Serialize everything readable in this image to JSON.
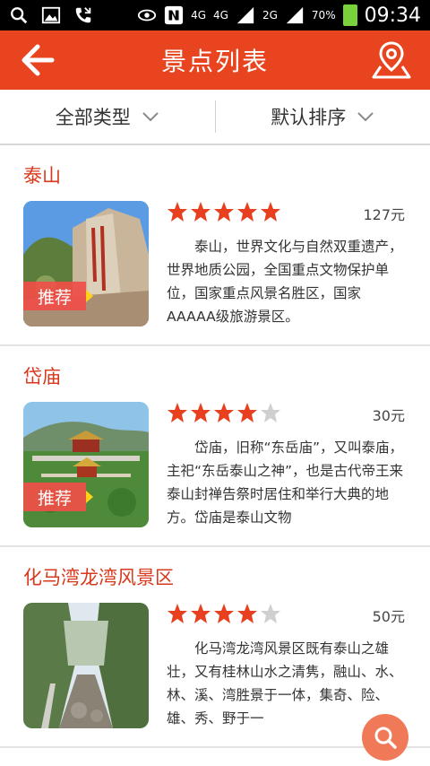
{
  "status_bar": {
    "icons": [
      "search-icon",
      "image-icon",
      "missed-call-icon",
      "eye-icon",
      "n-icon",
      "signal-icon",
      "signal-icon",
      "battery-icon"
    ],
    "net1": "4G",
    "net2": "4G",
    "net3": "2G",
    "battery": "70%",
    "time": "09:34"
  },
  "header": {
    "title": "景点列表",
    "back_icon": "back-arrow-icon",
    "map_icon": "map-pin-icon",
    "color": "#e8441f"
  },
  "filters": {
    "type_label": "全部类型",
    "sort_label": "默认排序"
  },
  "spots": [
    {
      "name": "泰山",
      "rating": 5,
      "max_rating": 5,
      "price": "127元",
      "recommended": true,
      "tag": "推荐",
      "description": "泰山，世界文化与自然双重遗产，世界地质公园，全国重点文物保护单位，国家重点风景名胜区，国家AAAAA级旅游景区。"
    },
    {
      "name": "岱庙",
      "rating": 4,
      "max_rating": 5,
      "price": "30元",
      "recommended": true,
      "tag": "推荐",
      "description": "岱庙，旧称“东岳庙”，又叫泰庙，主祀“东岳泰山之神”，也是古代帝王来泰山封禅告祭时居住和举行大典的地方。岱庙是泰山文物"
    },
    {
      "name": "化马湾龙湾风景区",
      "rating": 4,
      "max_rating": 5,
      "price": "50元",
      "recommended": false,
      "tag": "",
      "description": "化马湾龙湾风景区既有泰山之雄壮，又有桂林山水之清隽，融山、水、林、溪、湾胜景于一体，集奇、险、雄、秀、野于一"
    }
  ],
  "fab": {
    "icon": "search-icon",
    "color": "#f07a58"
  },
  "colors": {
    "accent": "#e8441f",
    "star_on": "#e8401f",
    "star_off": "#cfcfcf",
    "title_red": "#d8381b"
  }
}
